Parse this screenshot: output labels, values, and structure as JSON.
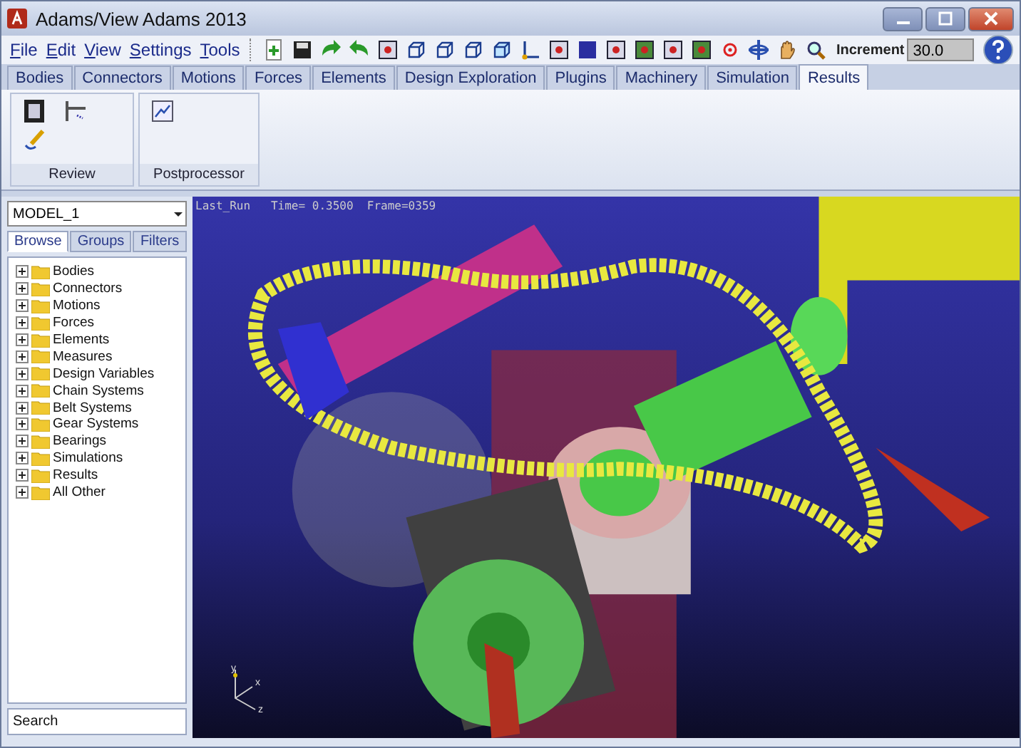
{
  "window": {
    "title": "Adams/View Adams 2013"
  },
  "menu": [
    "File",
    "Edit",
    "View",
    "Settings",
    "Tools"
  ],
  "toolbar": {
    "increment_label": "Increment",
    "increment_value": "30.0"
  },
  "tabs": [
    {
      "label": "Bodies",
      "selected": false
    },
    {
      "label": "Connectors",
      "selected": false
    },
    {
      "label": "Motions",
      "selected": false
    },
    {
      "label": "Forces",
      "selected": false
    },
    {
      "label": "Elements",
      "selected": false
    },
    {
      "label": "Design Exploration",
      "selected": false
    },
    {
      "label": "Plugins",
      "selected": false
    },
    {
      "label": "Machinery",
      "selected": false
    },
    {
      "label": "Simulation",
      "selected": false
    },
    {
      "label": "Results",
      "selected": true
    }
  ],
  "ribbon_groups": [
    {
      "label": "Review",
      "kind": "review"
    },
    {
      "label": "Postprocessor",
      "kind": "postprocessor"
    }
  ],
  "sidebar": {
    "model": "MODEL_1",
    "tabs": [
      {
        "label": "Browse",
        "selected": true
      },
      {
        "label": "Groups",
        "selected": false
      },
      {
        "label": "Filters",
        "selected": false
      }
    ],
    "items": [
      {
        "label": "Bodies",
        "expanded": false
      },
      {
        "label": "Connectors",
        "expanded": false
      },
      {
        "label": "Motions",
        "expanded": false
      },
      {
        "label": "Forces",
        "expanded": false
      },
      {
        "label": "Elements",
        "expanded": false
      },
      {
        "label": "Measures",
        "expanded": false
      },
      {
        "label": "Design Variables",
        "expanded": false
      },
      {
        "label": "Chain Systems",
        "expanded": false
      },
      {
        "label": "Belt Systems",
        "expanded": false
      },
      {
        "label": "Gear Systems",
        "expanded": false
      },
      {
        "label": "Bearings",
        "expanded": false
      },
      {
        "label": "Simulations",
        "expanded": false
      },
      {
        "label": "Results",
        "expanded": false
      },
      {
        "label": "All Other",
        "expanded": false
      }
    ],
    "search": {
      "placeholder": "Search"
    }
  },
  "viewport": {
    "run_info": "Last_Run   Time= 0.3500  Frame=0359",
    "axes": [
      "y",
      "x",
      "z"
    ]
  }
}
